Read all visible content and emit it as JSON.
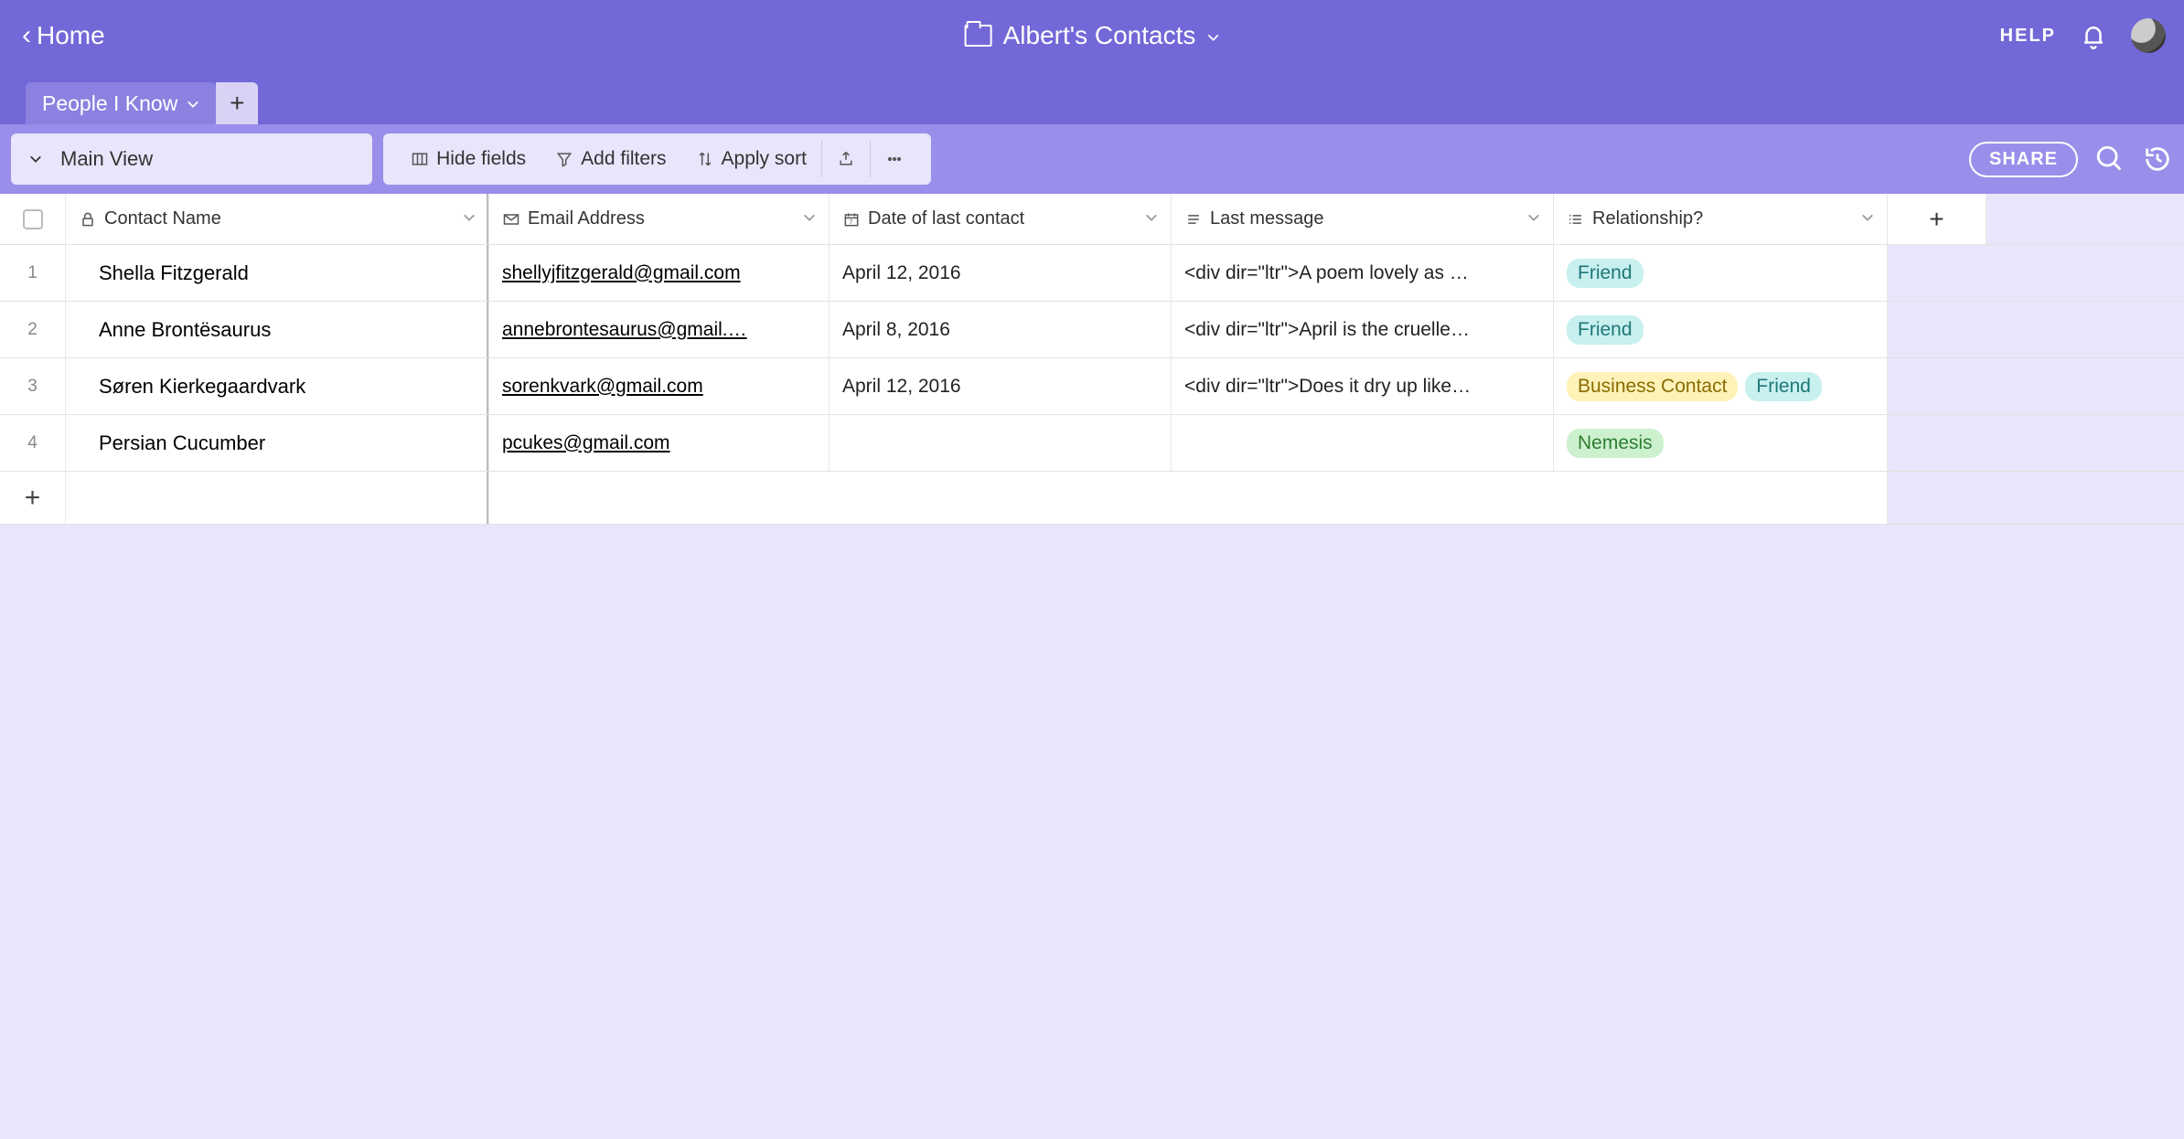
{
  "header": {
    "back_label": "Home",
    "title": "Albert's Contacts",
    "help_label": "HELP"
  },
  "tabs": {
    "items": [
      {
        "label": "People I Know"
      }
    ]
  },
  "toolbar": {
    "view_label": "Main View",
    "hide_fields": "Hide fields",
    "add_filters": "Add filters",
    "apply_sort": "Apply sort",
    "share_label": "SHARE"
  },
  "columns": {
    "contact_name": "Contact Name",
    "email": "Email Address",
    "date": "Date of last contact",
    "msg": "Last message",
    "rel": "Relationship?"
  },
  "rows": [
    {
      "idx": "1",
      "name": "Shella Fitzgerald",
      "email": "shellyjfitzgerald@gmail.com",
      "date": "April 12, 2016",
      "msg": "<div dir=\"ltr\">A poem lovely as …",
      "rel": [
        {
          "text": "Friend",
          "cls": "tag-friend"
        }
      ]
    },
    {
      "idx": "2",
      "name": "Anne Brontësaurus",
      "email": "annebrontesaurus@gmail.…",
      "date": "April 8, 2016",
      "msg": "<div dir=\"ltr\">April is the cruelle…",
      "rel": [
        {
          "text": "Friend",
          "cls": "tag-friend"
        }
      ]
    },
    {
      "idx": "3",
      "name": "Søren Kierkegaardvark",
      "email": "sorenkvark@gmail.com",
      "date": "April 12, 2016",
      "msg": "<div dir=\"ltr\">Does it dry up like…",
      "rel": [
        {
          "text": "Business Contact",
          "cls": "tag-biz"
        },
        {
          "text": "Friend",
          "cls": "tag-friend"
        }
      ]
    },
    {
      "idx": "4",
      "name": "Persian Cucumber",
      "email": "pcukes@gmail.com",
      "date": "",
      "msg": "",
      "rel": [
        {
          "text": "Nemesis",
          "cls": "tag-nemesis"
        }
      ]
    }
  ]
}
